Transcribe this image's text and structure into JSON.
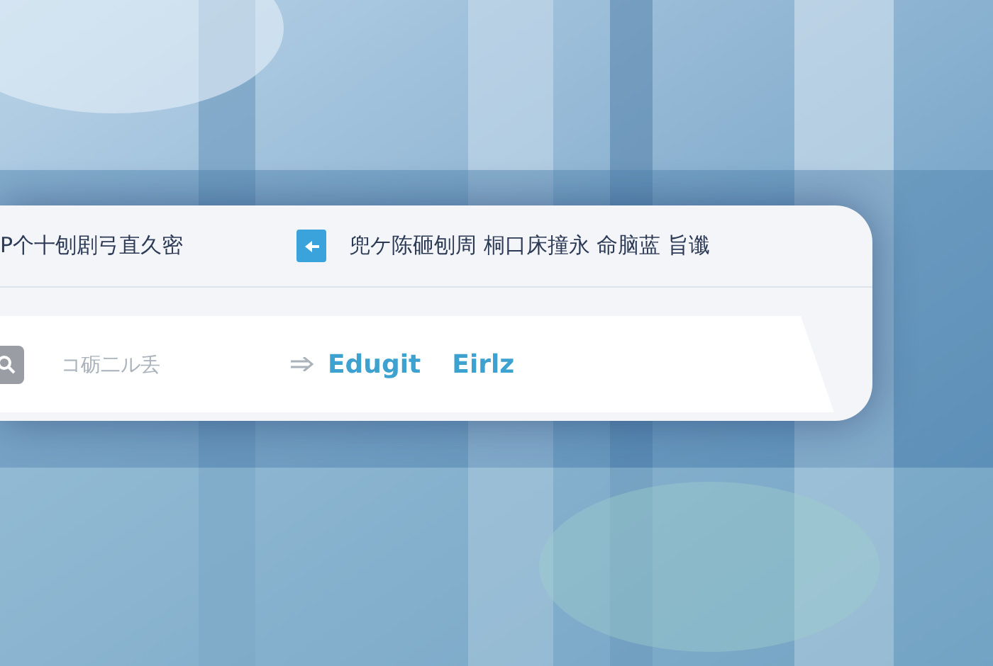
{
  "header": {
    "left_text": "P个十刨剧弓直久密",
    "right_text": "兜ケ陈砸刨周 桐口床撞永 命脑蓝 旨谶"
  },
  "search": {
    "placeholder": "コ砺二ル丢"
  },
  "links": [
    "Edugit",
    "Eirlz"
  ]
}
